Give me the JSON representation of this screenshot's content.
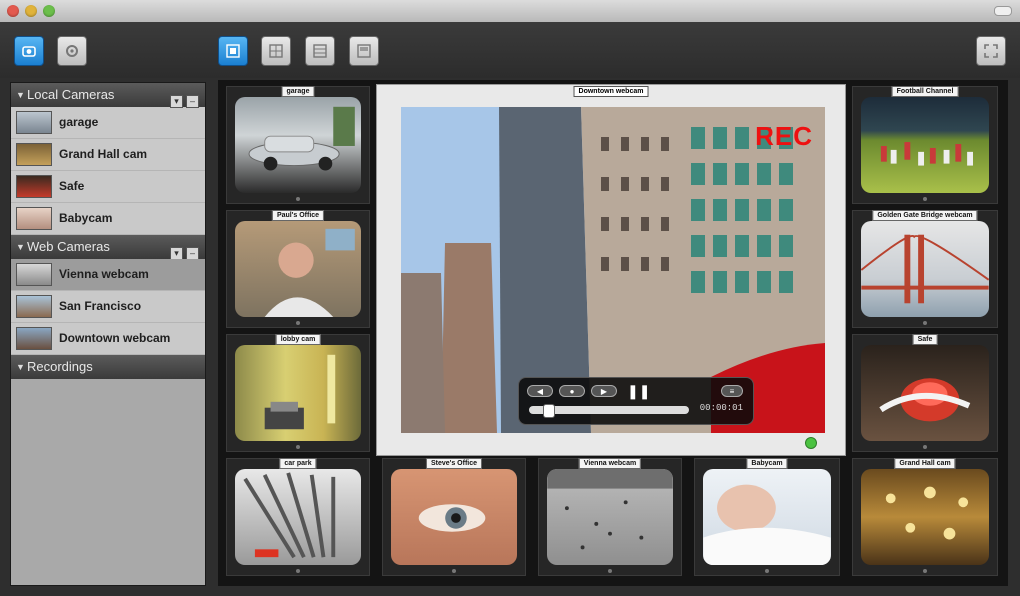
{
  "sidebar": {
    "sections": [
      {
        "title": "Local Cameras",
        "items": [
          "garage",
          "Grand Hall cam",
          "Safe",
          "Babycam"
        ]
      },
      {
        "title": "Web Cameras",
        "items": [
          "Vienna webcam",
          "San Francisco",
          "Downtown webcam"
        ]
      },
      {
        "title": "Recordings",
        "items": []
      }
    ],
    "selected": "Vienna webcam"
  },
  "main_feed": {
    "label": "Downtown webcam",
    "overlay_text": "REC",
    "time": "00:00:01"
  },
  "grid_labels": {
    "garage": "garage",
    "stairwell": "Paul's Office",
    "lobby": "lobby cam",
    "football": "Football Channel",
    "bridge": "Golden Gate Bridge webcam",
    "ring": "Safe",
    "gears": "car park",
    "eye": "Steve's Office",
    "vienna": "Vienna webcam",
    "baby": "Babycam",
    "hall": "Grand Hall cam"
  },
  "colors": {
    "accent_blue": "#1b7fd1",
    "rec_red": "#e11"
  }
}
